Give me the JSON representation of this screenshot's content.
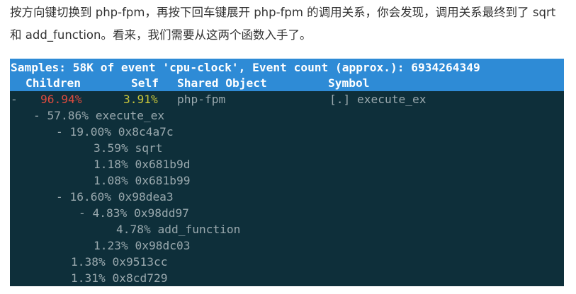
{
  "intro": {
    "text": "按方向键切换到 php-fpm，再按下回车键展开 php-fpm 的调用关系，你会发现，调用关系最终到了 sqrt 和 add_function。看来，我们需要从这两个函数入手了。"
  },
  "terminal": {
    "header": {
      "summary": "Samples: 58K of event 'cpu-clock', Event count (approx.): 6934264349",
      "columns": {
        "children": "Children",
        "self": "Self",
        "shared_object": "Shared Object",
        "symbol": "Symbol"
      }
    },
    "top_row": {
      "expander": "-",
      "children": "96.94%",
      "self": "3.91%",
      "shared_object": "php-fpm",
      "symbol": "[.] execute_ex"
    },
    "tree": [
      {
        "text": "- 57.86% execute_ex"
      },
      {
        "text": "- 19.00% 0x8c4a7c"
      },
      {
        "text": "3.59% sqrt"
      },
      {
        "text": "1.18% 0x681b9d"
      },
      {
        "text": "1.08% 0x681b99"
      },
      {
        "text": "- 16.60% 0x98dea3"
      },
      {
        "text": "- 4.83% 0x98dd97"
      },
      {
        "text": "4.78% add_function"
      },
      {
        "text": "1.23% 0x98dc03"
      },
      {
        "text": "1.38% 0x9513cc"
      },
      {
        "text": "1.31% 0x8cd729"
      }
    ],
    "colors": {
      "background": "#0e2f3a",
      "header_background": "#2e8bd6",
      "children_pct": "#dc4b3e",
      "self_pct": "#c6c43a",
      "text": "#9aa9ae"
    }
  }
}
